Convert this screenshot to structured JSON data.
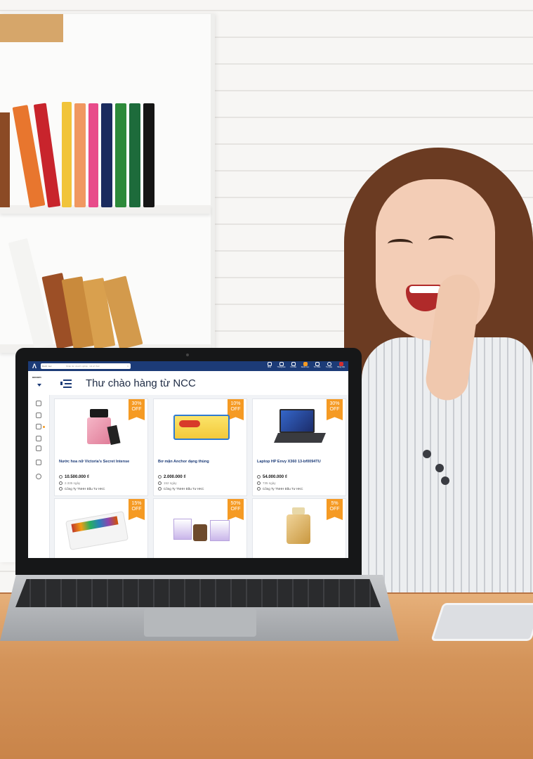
{
  "app": {
    "search": {
      "scope": "Danh mục",
      "placeholder": "Nhập tên doanh nghiệp, mã số thuế"
    },
    "toolbar": [
      "Mua",
      "Thông báo",
      "Yêu cầu",
      "Danh mục",
      "Tin nhắn",
      "Trợ giúp",
      "Tiếng Việt"
    ],
    "brand": "azoom",
    "page_title": "Thư chào hàng từ NCC",
    "colors": {
      "primary": "#1c3b77",
      "badge": "#f59a23",
      "title": "#1c3b77"
    }
  },
  "products": [
    {
      "name": "Nước hoa nữ Victoria's Secret Intense",
      "price": "10.500.000 ₫",
      "lead_time": "2.335 ngày",
      "seller": "Công Ty TNHH Đầu Tư HKC",
      "discount_pct": "30%",
      "discount_label": "OFF",
      "icon": "perfume-icon"
    },
    {
      "name": "Bơ mặn Anchor dạng thùng",
      "price": "2.000.000 ₫",
      "lead_time": "152 ngày",
      "seller": "Công Ty TNHH Đầu Tư HKC",
      "discount_pct": "10%",
      "discount_label": "OFF",
      "icon": "butter-icon"
    },
    {
      "name": "Laptop HP Envy X360 13-bf0094TU",
      "price": "54.000.000 ₫",
      "lead_time": "735 ngày",
      "seller": "Công Ty TNHH Đầu Tư HKC",
      "discount_pct": "30%",
      "discount_label": "OFF",
      "icon": "laptop-icon"
    },
    {
      "discount_pct": "15%",
      "discount_label": "OFF",
      "icon": "chocolate-box-icon"
    },
    {
      "discount_pct": "50%",
      "discount_label": "OFF",
      "icon": "supplement-icon"
    },
    {
      "discount_pct": "5%",
      "discount_label": "OFF",
      "icon": "perfume-gold-icon"
    }
  ]
}
